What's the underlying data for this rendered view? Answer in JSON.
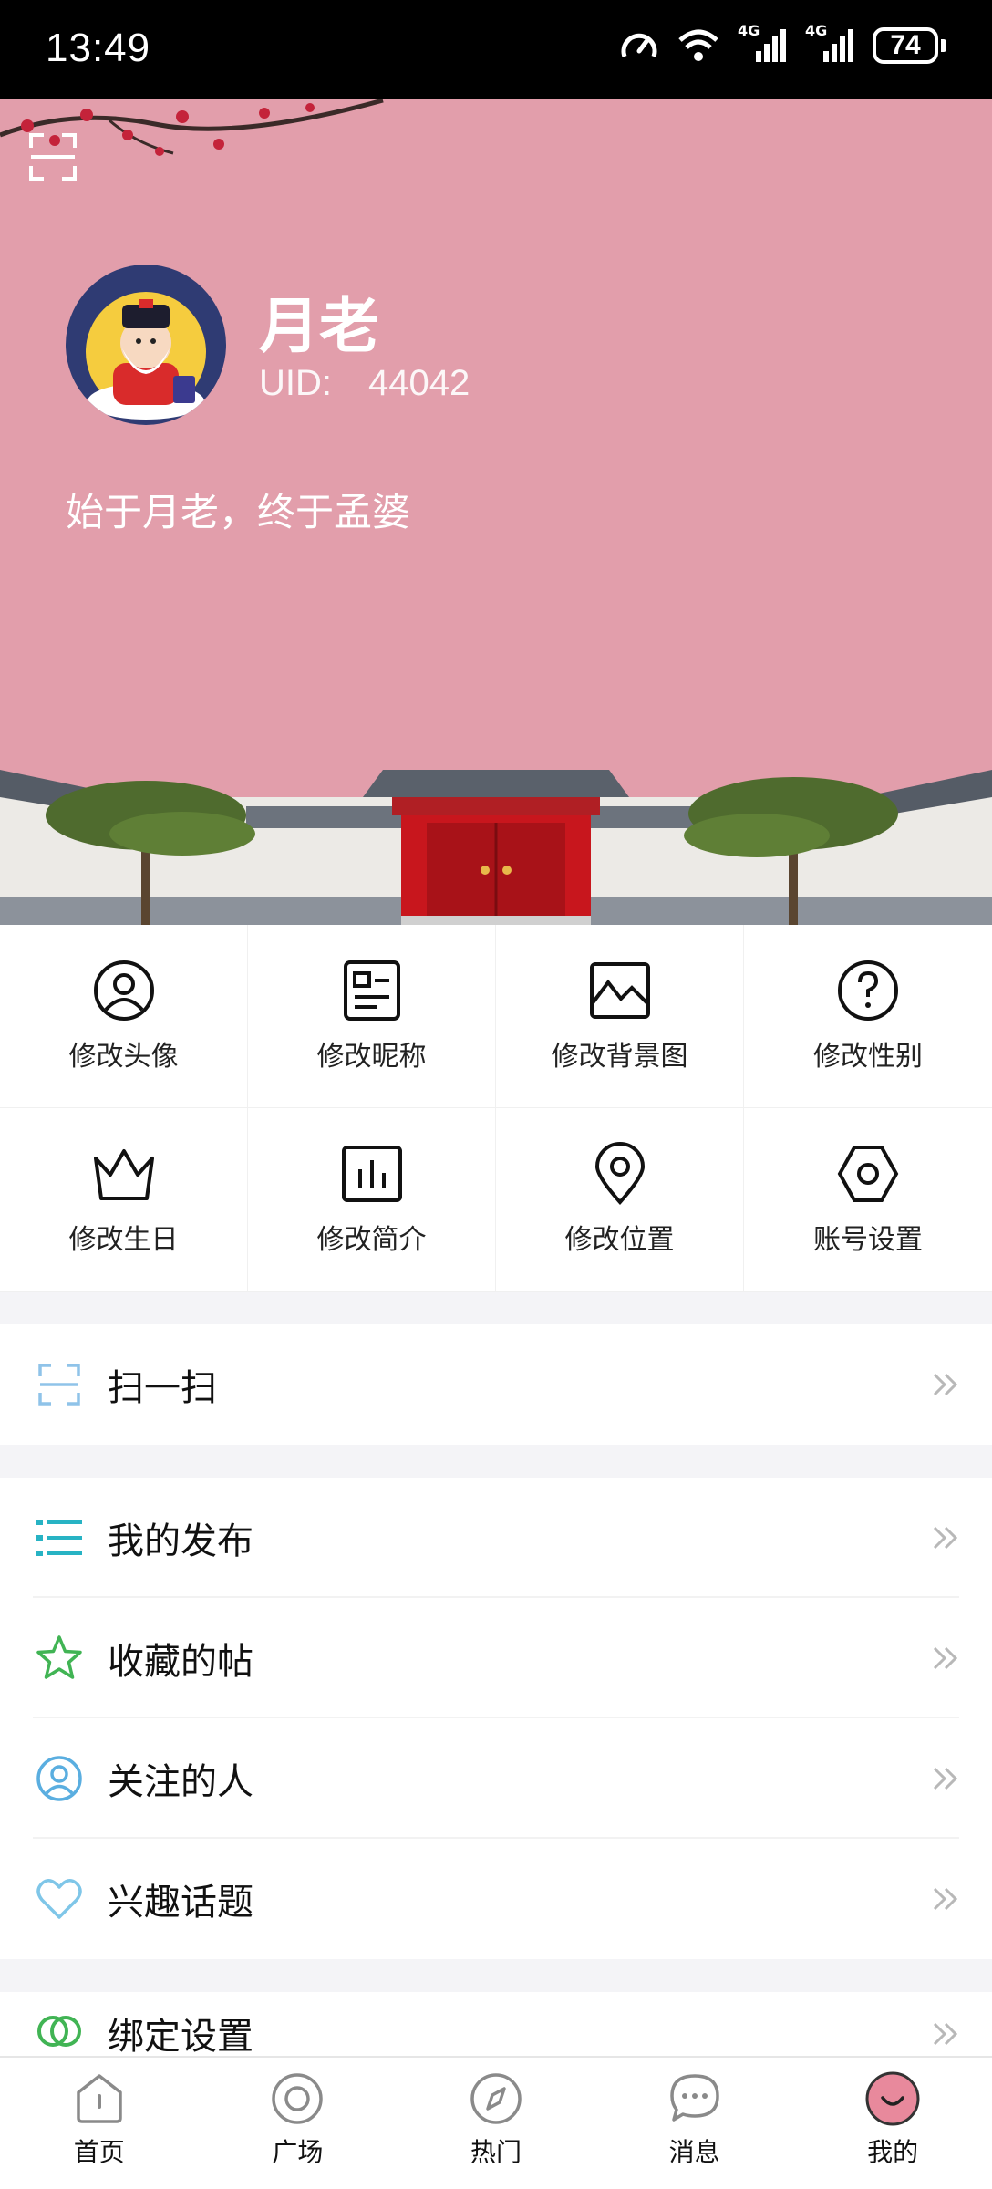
{
  "status_bar": {
    "time": "13:49",
    "network_1": "4G",
    "network_2": "4G",
    "battery": "74"
  },
  "profile": {
    "name": "月老",
    "uid_label": "UID:",
    "uid_value": "44042",
    "signature": "始于月老，终于孟婆",
    "header_color": "#e29eab"
  },
  "actions": [
    {
      "label": "修改头像",
      "icon": "user-circle-icon"
    },
    {
      "label": "修改昵称",
      "icon": "id-card-icon"
    },
    {
      "label": "修改背景图",
      "icon": "image-icon"
    },
    {
      "label": "修改性别",
      "icon": "question-circle-icon"
    },
    {
      "label": "修改生日",
      "icon": "crown-icon"
    },
    {
      "label": "修改简介",
      "icon": "chart-icon"
    },
    {
      "label": "修改位置",
      "icon": "location-pin-icon"
    },
    {
      "label": "账号设置",
      "icon": "hexagon-icon"
    }
  ],
  "menu": {
    "scan": {
      "label": "扫一扫",
      "icon": "scan-icon"
    },
    "my_posts": {
      "label": "我的发布",
      "icon": "list-icon"
    },
    "favorites": {
      "label": "收藏的帖",
      "icon": "star-icon"
    },
    "following": {
      "label": "关注的人",
      "icon": "user-icon"
    },
    "topics": {
      "label": "兴趣话题",
      "icon": "heart-icon"
    },
    "binding": {
      "label": "绑定设置",
      "icon": "link-icon"
    }
  },
  "tabs": [
    {
      "label": "首页",
      "icon": "home-icon"
    },
    {
      "label": "广场",
      "icon": "circle-icon"
    },
    {
      "label": "热门",
      "icon": "compass-icon"
    },
    {
      "label": "消息",
      "icon": "chat-icon"
    },
    {
      "label": "我的",
      "icon": "smile-icon",
      "active": true
    }
  ]
}
